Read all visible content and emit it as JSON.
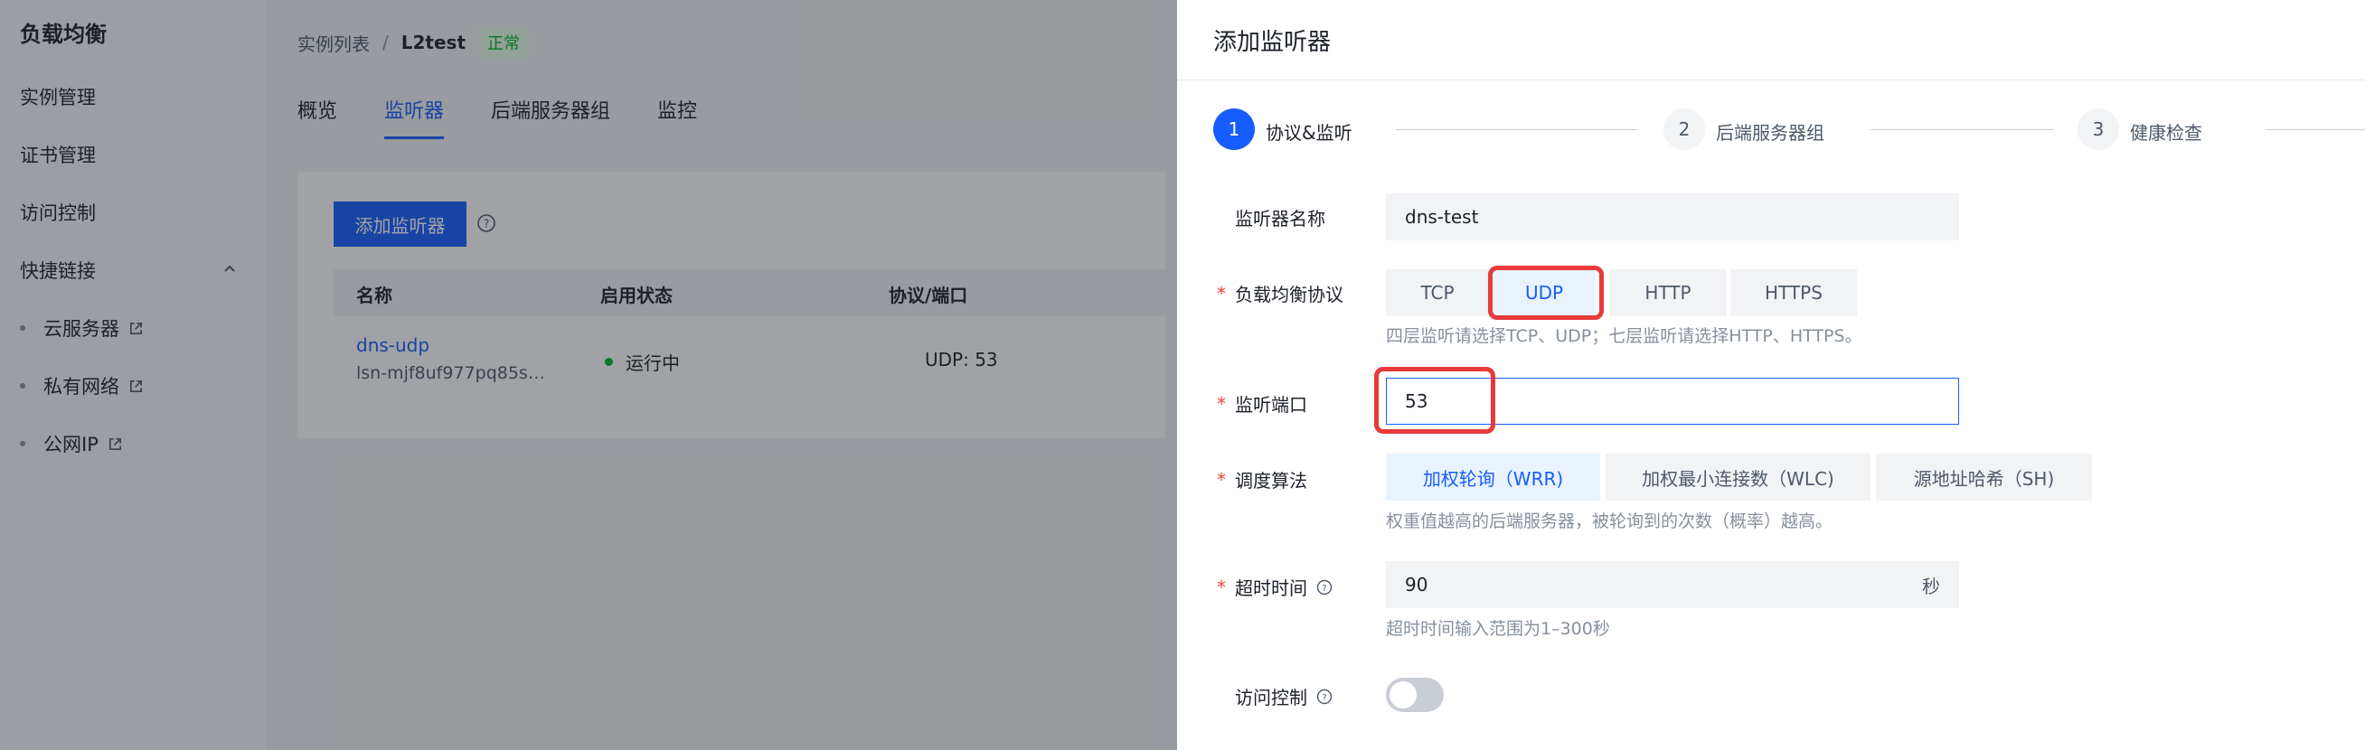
{
  "sidebar": {
    "title": "负载均衡",
    "items": [
      {
        "label": "实例管理"
      },
      {
        "label": "证书管理"
      },
      {
        "label": "访问控制"
      },
      {
        "label": "快捷链接"
      }
    ],
    "quick_links": [
      {
        "label": "云服务器"
      },
      {
        "label": "私有网络"
      },
      {
        "label": "公网IP"
      }
    ]
  },
  "breadcrumb": {
    "root": "实例列表",
    "separator": "/",
    "current": "L2test",
    "status_badge": "正常"
  },
  "tabs": [
    {
      "label": "概览"
    },
    {
      "label": "监听器",
      "active": true
    },
    {
      "label": "后端服务器组"
    },
    {
      "label": "监控"
    }
  ],
  "listener_table": {
    "add_button": "添加监听器",
    "columns": [
      "名称",
      "启用状态",
      "协议/端口"
    ],
    "rows": [
      {
        "name": "dns-udp",
        "id": "lsn-mjf8uf977pq85s…",
        "status": "运行中",
        "protocol_port": "UDP: 53"
      }
    ]
  },
  "drawer": {
    "title": "添加监听器",
    "steps": [
      {
        "number": "1",
        "label": "协议&监听",
        "active": true
      },
      {
        "number": "2",
        "label": "后端服务器组"
      },
      {
        "number": "3",
        "label": "健康检查"
      }
    ],
    "form": {
      "name": {
        "label": "监听器名称",
        "value": "dns-test"
      },
      "protocol": {
        "label": "负载均衡协议",
        "options": [
          "TCP",
          "UDP",
          "HTTP",
          "HTTPS"
        ],
        "selected": "UDP",
        "hint": "四层监听请选择TCP、UDP；七层监听请选择HTTP、HTTPS。"
      },
      "port": {
        "label": "监听端口",
        "value": "53"
      },
      "algorithm": {
        "label": "调度算法",
        "options": [
          "加权轮询（WRR)",
          "加权最小连接数（WLC)",
          "源地址哈希（SH)"
        ],
        "selected": "加权轮询（WRR)",
        "hint": "权重值越高的后端服务器，被轮询到的次数（概率）越高。"
      },
      "timeout": {
        "label": "超时时间",
        "value": "90",
        "unit": "秒",
        "hint": "超时时间输入范围为1–300秒"
      },
      "access_control": {
        "label": "访问控制",
        "enabled": false
      }
    },
    "required_mark": "*"
  },
  "colors": {
    "primary": "#165dff",
    "success": "#00b42a",
    "danger": "#f53f3f",
    "highlight_box": "#e83a3a"
  }
}
